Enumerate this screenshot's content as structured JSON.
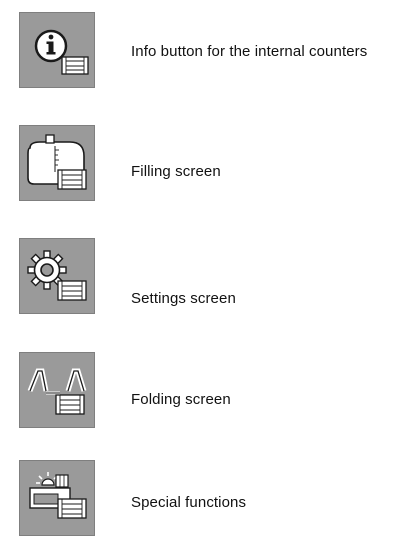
{
  "items": [
    {
      "label": "Info button for the internal counters",
      "icon": "info-icon"
    },
    {
      "label": "Filling screen",
      "icon": "tank-icon"
    },
    {
      "label": "Settings screen",
      "icon": "gear-icon"
    },
    {
      "label": "Folding screen",
      "icon": "boom-fold-icon"
    },
    {
      "label": "Special functions",
      "icon": "special-functions-icon"
    }
  ],
  "colors": {
    "button_background": "#9a9a9a",
    "icon_fill": "#ffffff",
    "icon_stroke": "#1a1a1a"
  }
}
